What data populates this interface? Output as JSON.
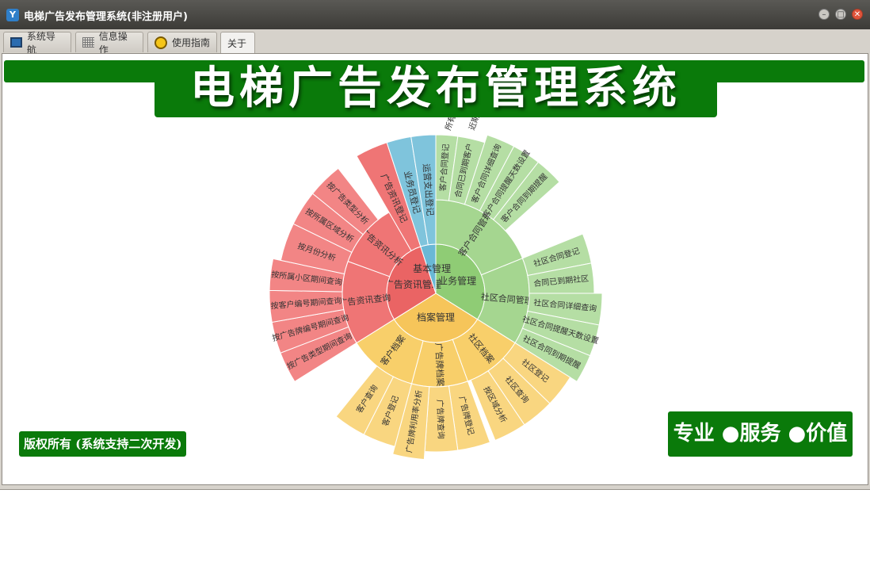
{
  "window": {
    "title": "电梯广告发布管理系统(非注册用户)"
  },
  "tabs": [
    {
      "label": "系统导航",
      "icon": "monitor-icon"
    },
    {
      "label": "信息操作",
      "icon": "grid-icon"
    },
    {
      "label": "使用指南",
      "icon": "lightbulb-icon"
    },
    {
      "label": "关于",
      "icon": ""
    }
  ],
  "banner": {
    "title": "电梯广告发布管理系统"
  },
  "footer": {
    "copyright": "版权所有 (系统支持二次开发)",
    "slogan": "专业 ●服务 ●价值"
  },
  "colors": {
    "brand_green": "#0a7a0a",
    "green": "#a5d690",
    "red": "#ef7575",
    "yellow": "#f8cf6a",
    "blue": "#7fc4dc"
  },
  "chart_data": {
    "type": "sunburst",
    "root": [
      {
        "name": "业务管理",
        "color": "#8fcc75",
        "start": 0,
        "end": 122,
        "children": [
          {
            "name": "客户合同管理",
            "start": 0,
            "end": 68,
            "children": [
              {
                "name": "客户合同登记",
                "start": 0,
                "end": 8
              },
              {
                "name": "合同已到期客户",
                "start": 8,
                "end": 18
              },
              {
                "name": "客户合同详细查询",
                "start": 18,
                "end": 28
              },
              {
                "name": "客户合同提醒天数设置",
                "start": 28,
                "end": 38
              },
              {
                "name": "客户合同到期提醒",
                "start": 38,
                "end": 48
              }
            ]
          },
          {
            "name": "社区合同管理",
            "start": 68,
            "end": 122,
            "children": [
              {
                "name": "社区合同登记",
                "start": 68,
                "end": 79
              },
              {
                "name": "合同已到期社区",
                "start": 79,
                "end": 90
              },
              {
                "name": "社区合同详细查询",
                "start": 90,
                "end": 101
              },
              {
                "name": "社区合同提醒天数设置",
                "start": 101,
                "end": 112
              },
              {
                "name": "社区合同到期提醒",
                "start": 112,
                "end": 122
              }
            ]
          }
        ]
      },
      {
        "name": "档案管理",
        "color": "#f6c55a",
        "start": 122,
        "end": 238,
        "children": [
          {
            "name": "社区档案",
            "start": 122,
            "end": 160,
            "children": [
              {
                "name": "社区登记",
                "start": 122,
                "end": 134
              },
              {
                "name": "社区查询",
                "start": 134,
                "end": 146
              },
              {
                "name": "按区域分析",
                "start": 146,
                "end": 158
              }
            ]
          },
          {
            "name": "广告牌档案",
            "start": 160,
            "end": 195,
            "children": [
              {
                "name": "广告牌登记",
                "start": 160,
                "end": 172
              },
              {
                "name": "广告牌查询",
                "start": 172,
                "end": 184
              },
              {
                "name": "广告牌利用率分析",
                "start": 184,
                "end": 195
              }
            ]
          },
          {
            "name": "客户档案",
            "start": 195,
            "end": 238,
            "children": [
              {
                "name": "客户登记",
                "start": 195,
                "end": 207
              },
              {
                "name": "客户查询",
                "start": 207,
                "end": 219
              }
            ]
          }
        ]
      },
      {
        "name": "广告资讯管理",
        "color": "#ea6464",
        "start": 238,
        "end": 342,
        "children": [
          {
            "name": "广告资讯查询",
            "start": 238,
            "end": 290,
            "children": [
              {
                "name": "按广告类型期间查询",
                "start": 238,
                "end": 249
              },
              {
                "name": "按广告牌编号期间查询",
                "start": 249,
                "end": 260
              },
              {
                "name": "按客户编号期间查询",
                "start": 260,
                "end": 271
              },
              {
                "name": "按所属小区期间查询",
                "start": 271,
                "end": 282
              }
            ]
          },
          {
            "name": "广告资讯分析",
            "start": 290,
            "end": 330,
            "children": [
              {
                "name": "按月份分析",
                "start": 282,
                "end": 296
              },
              {
                "name": "按所属区域分析",
                "start": 296,
                "end": 309
              },
              {
                "name": "按广告类型分析",
                "start": 309,
                "end": 322
              }
            ]
          },
          {
            "name": "广告资讯登记",
            "start": 330,
            "end": 342,
            "children": []
          }
        ]
      },
      {
        "name": "基本管理",
        "color": "#6ab8d6",
        "start": 342,
        "end": 360,
        "children": [
          {
            "name": "业务员登记",
            "start": 342,
            "end": 351,
            "children": []
          },
          {
            "name": "运营支出登记",
            "start": 351,
            "end": 360,
            "children": []
          }
        ]
      }
    ],
    "partial_labels": [
      "所有文",
      "近期文"
    ]
  }
}
